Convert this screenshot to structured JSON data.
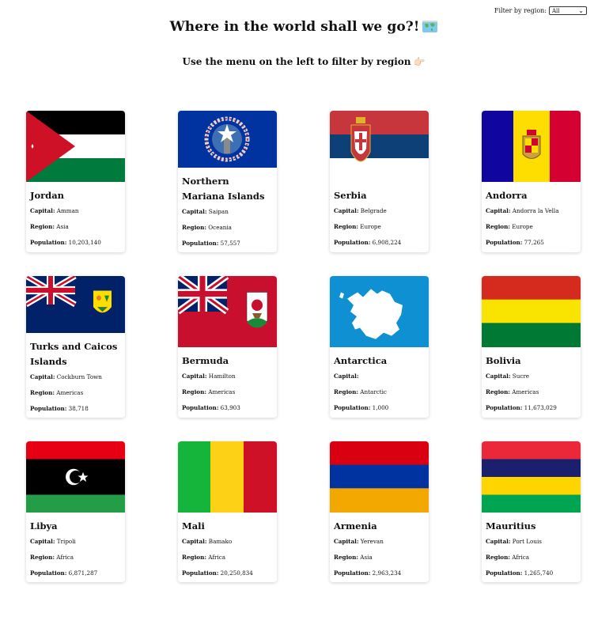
{
  "filter": {
    "label": "Filter by region:",
    "selected": "All"
  },
  "header": {
    "title": "Where in the world shall we go?!",
    "subtitle": "Use the menu on the left to filter by region",
    "subtitle_emoji": "👉🏻"
  },
  "labels": {
    "capital": "Capital:",
    "region": "Region:",
    "population": "Population:"
  },
  "countries": [
    {
      "name": "Jordan",
      "capital": "Amman",
      "region": "Asia",
      "population": "10,203,140",
      "flag": "jordan"
    },
    {
      "name": "Northern Mariana Islands",
      "capital": "Saipan",
      "region": "Oceania",
      "population": "57,557",
      "flag": "northern-mariana"
    },
    {
      "name": "Serbia",
      "capital": "Belgrade",
      "region": "Europe",
      "population": "6,908,224",
      "flag": "serbia"
    },
    {
      "name": "Andorra",
      "capital": "Andorra la Vella",
      "region": "Europe",
      "population": "77,265",
      "flag": "andorra"
    },
    {
      "name": "Turks and Caicos Islands",
      "capital": "Cockburn Town",
      "region": "Americas",
      "population": "38,718",
      "flag": "turks-caicos"
    },
    {
      "name": "Bermuda",
      "capital": "Hamilton",
      "region": "Americas",
      "population": "63,903",
      "flag": "bermuda"
    },
    {
      "name": "Antarctica",
      "capital": "",
      "region": "Antarctic",
      "population": "1,000",
      "flag": "antarctica"
    },
    {
      "name": "Bolivia",
      "capital": "Sucre",
      "region": "Americas",
      "population": "11,673,029",
      "flag": "bolivia"
    },
    {
      "name": "Libya",
      "capital": "Tripoli",
      "region": "Africa",
      "population": "6,871,287",
      "flag": "libya"
    },
    {
      "name": "Mali",
      "capital": "Bamako",
      "region": "Africa",
      "population": "20,250,834",
      "flag": "mali"
    },
    {
      "name": "Armenia",
      "capital": "Yerevan",
      "region": "Asia",
      "population": "2,963,234",
      "flag": "armenia"
    },
    {
      "name": "Mauritius",
      "capital": "Port Louis",
      "region": "Africa",
      "population": "1,265,740",
      "flag": "mauritius"
    }
  ]
}
